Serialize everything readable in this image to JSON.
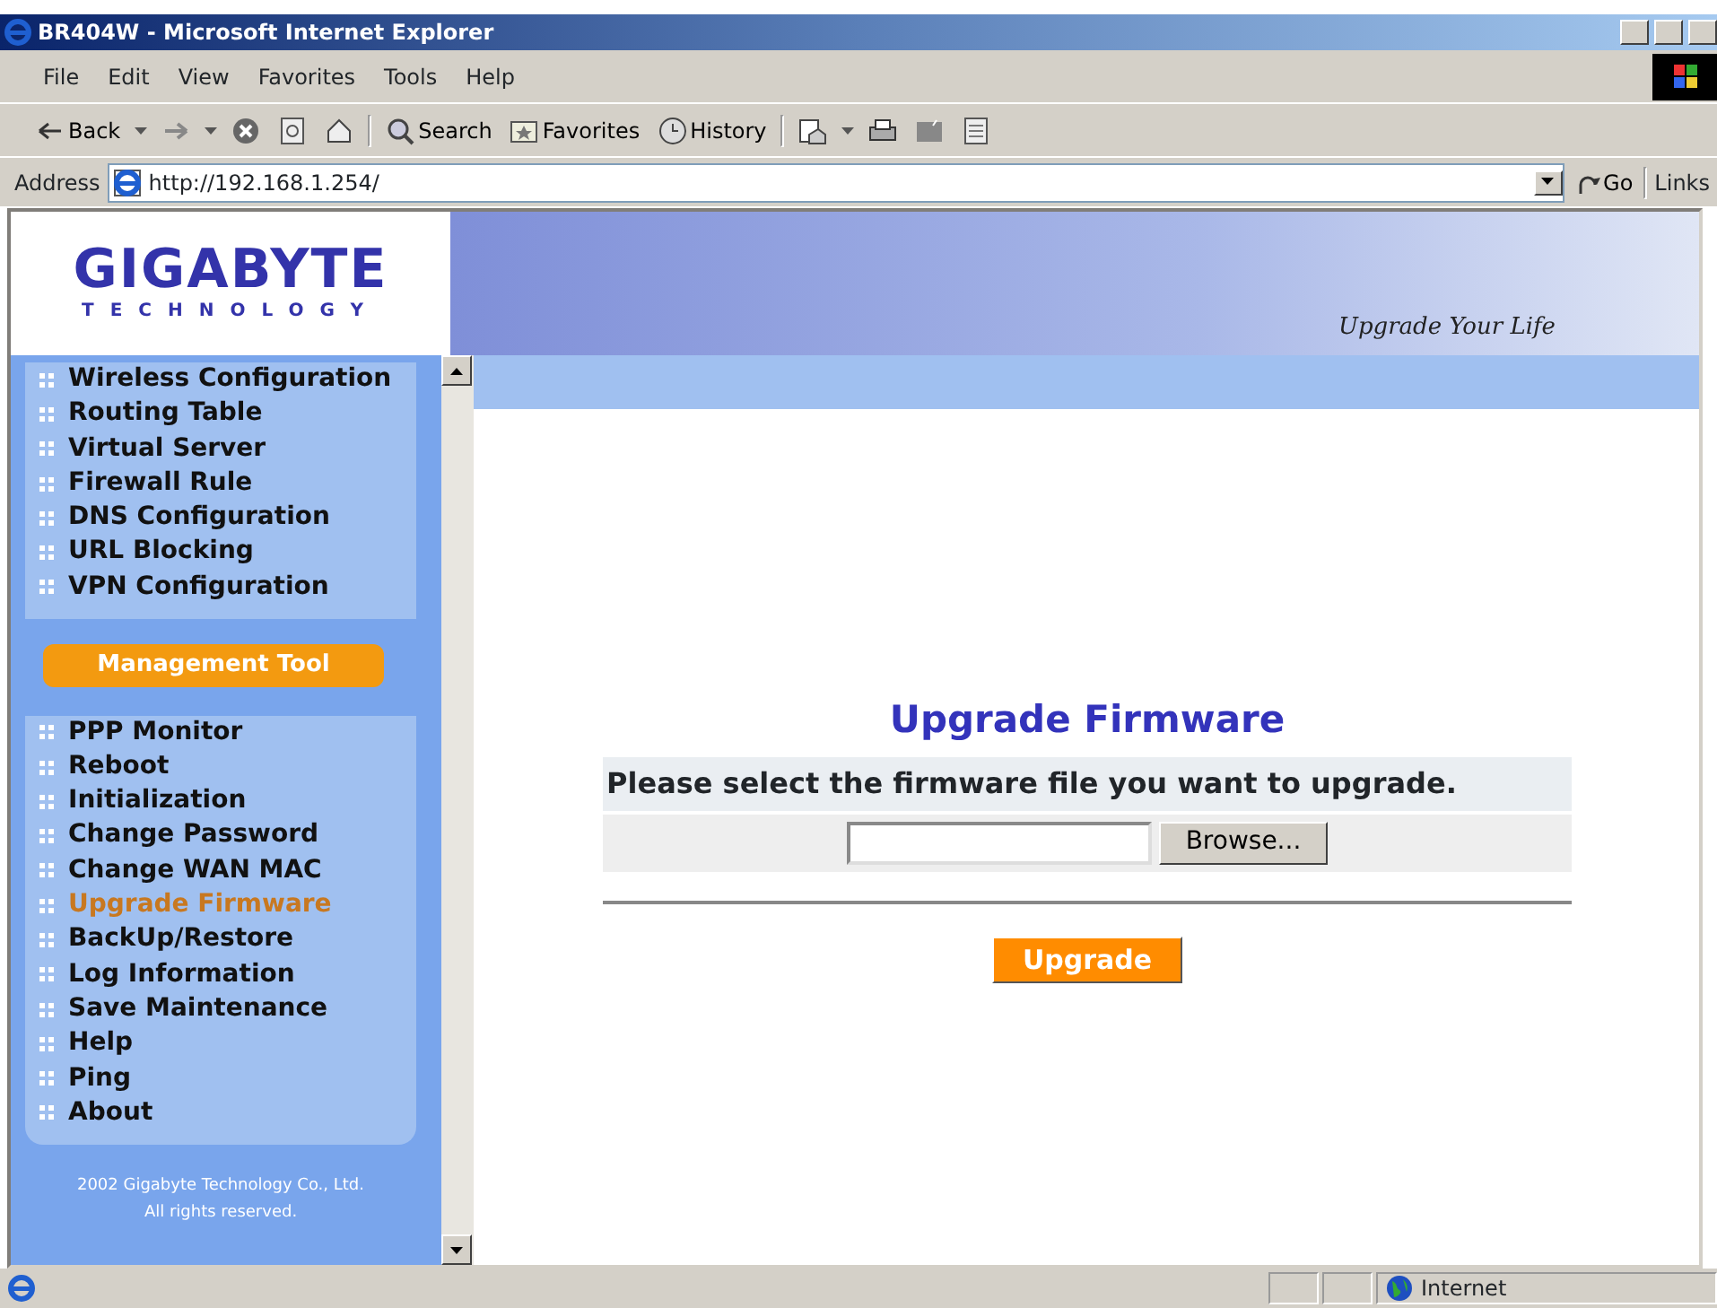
{
  "window": {
    "title": "BR404W - Microsoft Internet Explorer"
  },
  "menu_bar": [
    "File",
    "Edit",
    "View",
    "Favorites",
    "Tools",
    "Help"
  ],
  "toolbar": [
    {
      "kind": "back",
      "label": "Back"
    },
    {
      "kind": "forward"
    },
    {
      "kind": "stop"
    },
    {
      "kind": "refresh"
    },
    {
      "kind": "home"
    },
    {
      "kind": "search",
      "label": "Search"
    },
    {
      "kind": "favorites",
      "label": "Favorites"
    },
    {
      "kind": "history",
      "label": "History"
    },
    {
      "kind": "mail"
    },
    {
      "kind": "print"
    },
    {
      "kind": "edit"
    },
    {
      "kind": "discuss"
    }
  ],
  "address_bar": {
    "label": "Address",
    "value": "http://192.168.1.254/",
    "go": "Go",
    "links": "Links"
  },
  "header": {
    "logo": "GIGABYTE",
    "logo_sub": "TECHNOLOGY",
    "tagline": "Upgrade Your Life"
  },
  "sidebar": {
    "items": [
      {
        "label": "Wireless Configuration",
        "selected": false
      },
      {
        "label": "Routing Table",
        "selected": false
      },
      {
        "label": "Virtual Server",
        "selected": false
      },
      {
        "label": "Firewall Rule",
        "selected": false
      },
      {
        "label": "DNS Configuration",
        "selected": false
      },
      {
        "label": "URL Blocking",
        "selected": false
      },
      {
        "label": "VPN Configuration",
        "selected": false
      }
    ],
    "section": "Management Tool",
    "tools": [
      {
        "label": "PPP Monitor",
        "selected": false
      },
      {
        "label": "Reboot",
        "selected": false
      },
      {
        "label": "Initialization",
        "selected": false
      },
      {
        "label": "Change Password",
        "selected": false
      },
      {
        "label": "Change WAN MAC",
        "selected": false
      },
      {
        "label": "Upgrade Firmware",
        "selected": true
      },
      {
        "label": "BackUp/Restore",
        "selected": false
      },
      {
        "label": "Log Information",
        "selected": false
      },
      {
        "label": "Save Maintenance",
        "selected": false
      },
      {
        "label": "Help",
        "selected": false
      },
      {
        "label": "Ping",
        "selected": false
      },
      {
        "label": "About",
        "selected": false
      }
    ],
    "footer": [
      "2002 Gigabyte Technology Co., Ltd.",
      "All rights reserved."
    ]
  },
  "content": {
    "heading": "Upgrade Firmware",
    "prompt": "Please select the firmware file you want to upgrade.",
    "browse": "Browse...",
    "upgrade": "Upgrade"
  },
  "status_bar": {
    "zone": "Internet"
  }
}
